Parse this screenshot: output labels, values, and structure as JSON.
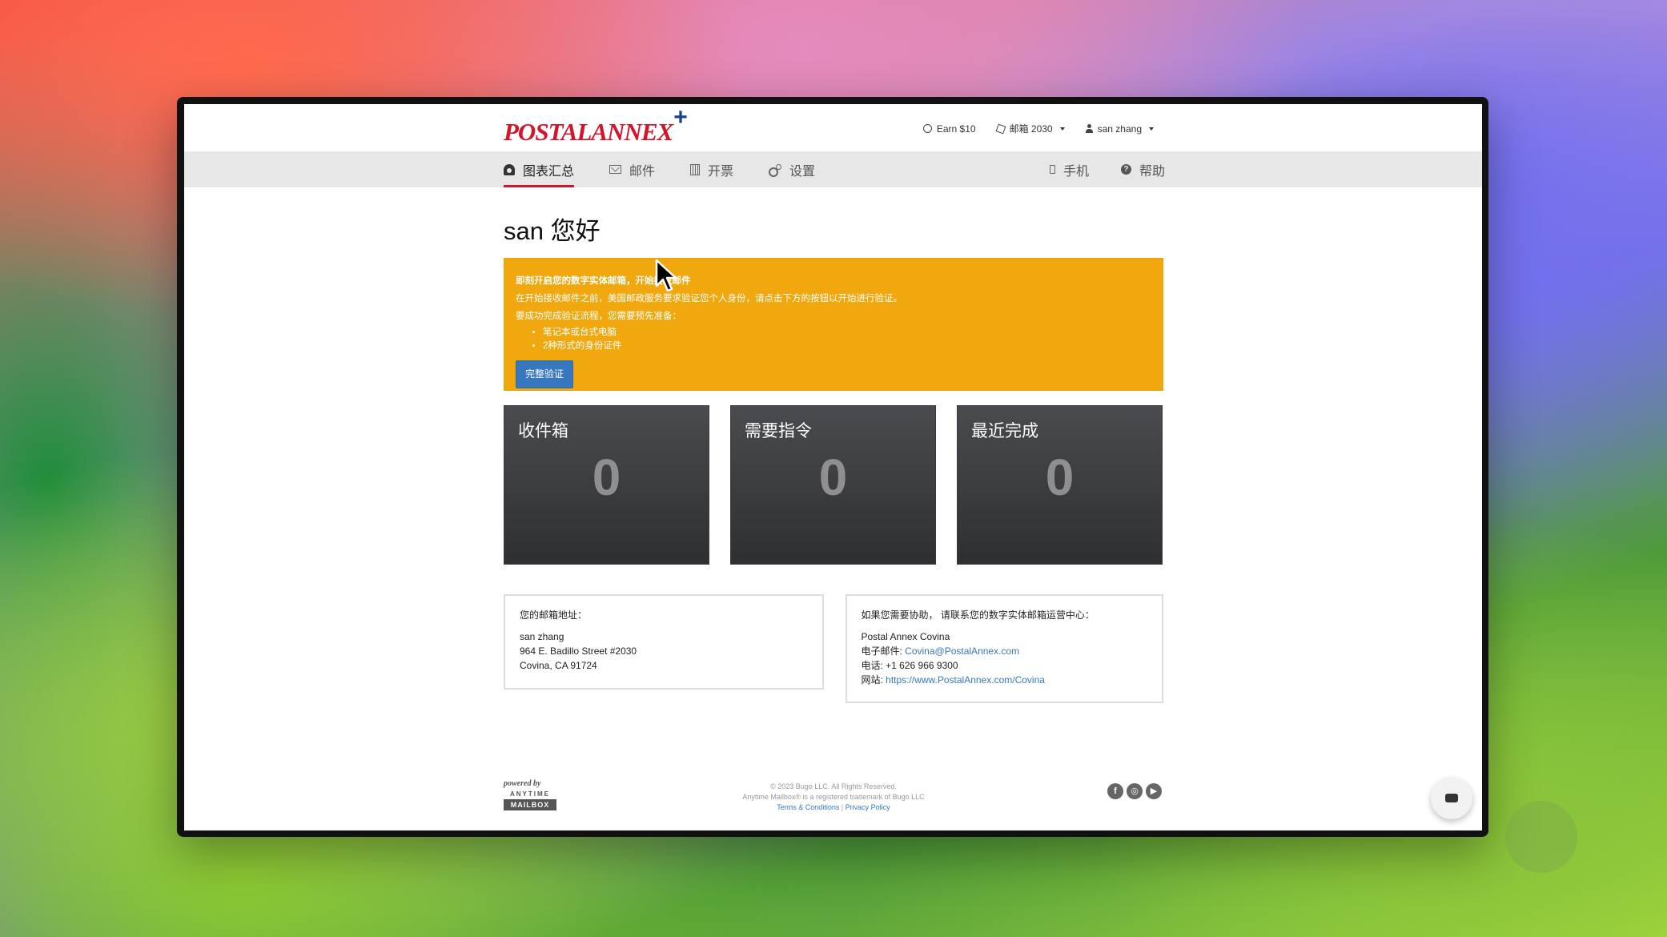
{
  "brand": {
    "logo_text": "POSTALANNEX",
    "logo_plus": "+"
  },
  "header": {
    "earn": "Earn $10",
    "mailbox": "邮箱 2030",
    "user": "san zhang"
  },
  "nav": {
    "left": [
      {
        "label": "图表汇总",
        "icon": "dashboard-icon",
        "active": true
      },
      {
        "label": "邮件",
        "icon": "envelope-icon"
      },
      {
        "label": "开票",
        "icon": "calculator-icon"
      },
      {
        "label": "设置",
        "icon": "gears-icon"
      }
    ],
    "right": [
      {
        "label": "手机",
        "icon": "mobile-icon"
      },
      {
        "label": "帮助",
        "icon": "help-icon"
      }
    ]
  },
  "main": {
    "greeting": "san 您好",
    "alert": {
      "title": "即刻开启您的数字实体邮箱，开始接收邮件",
      "line1": "在开始接收邮件之前，美国邮政服务要求验证您个人身份，请点击下方的按钮以开始进行验证。",
      "line2": "要成功完成验证流程，您需要预先准备：",
      "items": [
        "笔记本或台式电脑",
        "2种形式的身份证件"
      ],
      "button": "完整验证"
    },
    "tiles": [
      {
        "label": "收件箱",
        "count": "0"
      },
      {
        "label": "需要指令",
        "count": "0"
      },
      {
        "label": "最近完成",
        "count": "0"
      }
    ],
    "address_card": {
      "heading": "您的邮箱地址：",
      "name": "san zhang",
      "street": "964 E. Badillo Street #2030",
      "city": "Covina, CA 91724"
    },
    "help_card": {
      "heading": "如果您需要协助， 请联系您的数字实体邮箱运营中心：",
      "center": "Postal Annex Covina",
      "email_label": "电子邮件: ",
      "email": "Covina@PostalAnnex.com",
      "phone": "电话: +1 626 966 9300",
      "web_label": "网站: ",
      "web": "https://www.PostalAnnex.com/Covina"
    }
  },
  "footer": {
    "powered_by": "powered by",
    "anytime": "ANYTIME",
    "mailbox": "MAILBOX",
    "copyright": "© 2023 Bugo LLC. All Rights Reserved.",
    "trademark": "Anytime Mailbox® is a registered trademark of Bugo LLC",
    "terms": "Terms & Conditions",
    "separator": " | ",
    "privacy": "Privacy Policy",
    "socials": [
      {
        "icon": "facebook-icon",
        "glyph": "f"
      },
      {
        "icon": "instagram-icon",
        "glyph": "◎"
      },
      {
        "icon": "youtube-icon",
        "glyph": "▶"
      }
    ]
  },
  "colors": {
    "brand_red": "#d4142a",
    "alert_orange": "#f1a80f",
    "link_blue": "#3677be",
    "tile_dark": "#3a3b3d"
  }
}
